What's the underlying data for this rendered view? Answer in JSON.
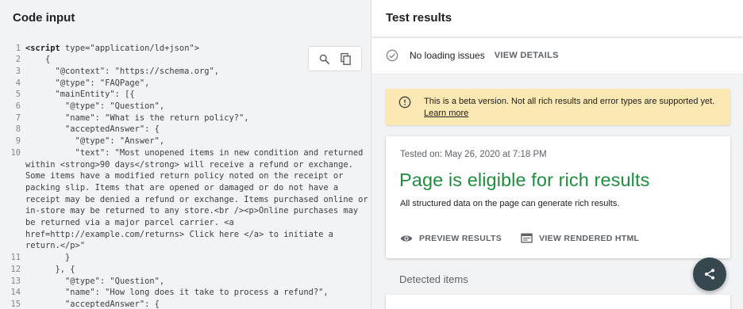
{
  "left_panel": {
    "title": "Code input",
    "toolbar": {
      "search_icon": "search-icon",
      "copy_icon": "copy-icon"
    },
    "code_lines": [
      {
        "n": "1",
        "pre": "",
        "kw": "<script",
        "post": " type=\"application/ld+json\">"
      },
      {
        "n": "2",
        "text": "    {"
      },
      {
        "n": "3",
        "text": "      \"@context\": \"https://schema.org\","
      },
      {
        "n": "4",
        "text": "      \"@type\": \"FAQPage\","
      },
      {
        "n": "5",
        "text": "      \"mainEntity\": [{"
      },
      {
        "n": "6",
        "text": "        \"@type\": \"Question\","
      },
      {
        "n": "7",
        "text": "        \"name\": \"What is the return policy?\","
      },
      {
        "n": "8",
        "text": "        \"acceptedAnswer\": {"
      },
      {
        "n": "9",
        "text": "          \"@type\": \"Answer\","
      },
      {
        "n": "10",
        "text": "          \"text\": \"Most unopened items in new condition and returned"
      },
      {
        "n": "",
        "text": "within <strong>90 days</strong> will receive a refund or exchange."
      },
      {
        "n": "",
        "text": "Some items have a modified return policy noted on the receipt or"
      },
      {
        "n": "",
        "text": "packing slip. Items that are opened or damaged or do not have a"
      },
      {
        "n": "",
        "text": "receipt may be denied a refund or exchange. Items purchased online or"
      },
      {
        "n": "",
        "text": "in-store may be returned to any store.<br /><p>Online purchases may"
      },
      {
        "n": "",
        "text": "be returned via a major parcel carrier. <a"
      },
      {
        "n": "",
        "text": "href=http://example.com/returns> Click here </a> to initiate a"
      },
      {
        "n": "",
        "text": "return.</p>\""
      },
      {
        "n": "11",
        "text": "        }"
      },
      {
        "n": "12",
        "text": "      }, {"
      },
      {
        "n": "13",
        "text": "        \"@type\": \"Question\","
      },
      {
        "n": "14",
        "text": "        \"name\": \"How long does it take to process a refund?\","
      },
      {
        "n": "15",
        "text": "        \"acceptedAnswer\": {"
      }
    ]
  },
  "right_panel": {
    "title": "Test results",
    "loading": {
      "status": "No loading issues",
      "link": "VIEW DETAILS"
    },
    "beta_banner": {
      "text": "This is a beta version. Not all rich results and error types are supported yet.",
      "link": "Learn more"
    },
    "result_card": {
      "tested_on": "Tested on: May 26, 2020 at 7:18 PM",
      "headline": "Page is eligible for rich results",
      "subtext": "All structured data on the page can generate rich results.",
      "preview_label": "PREVIEW RESULTS",
      "rendered_label": "VIEW RENDERED HTML"
    },
    "detected_title": "Detected items",
    "share_icon": "share-icon"
  },
  "colors": {
    "success_green": "#1e8e3e",
    "banner_yellow": "#fce8b2",
    "fab_dark": "#37474f",
    "panel_gray": "#f1f3f4"
  }
}
